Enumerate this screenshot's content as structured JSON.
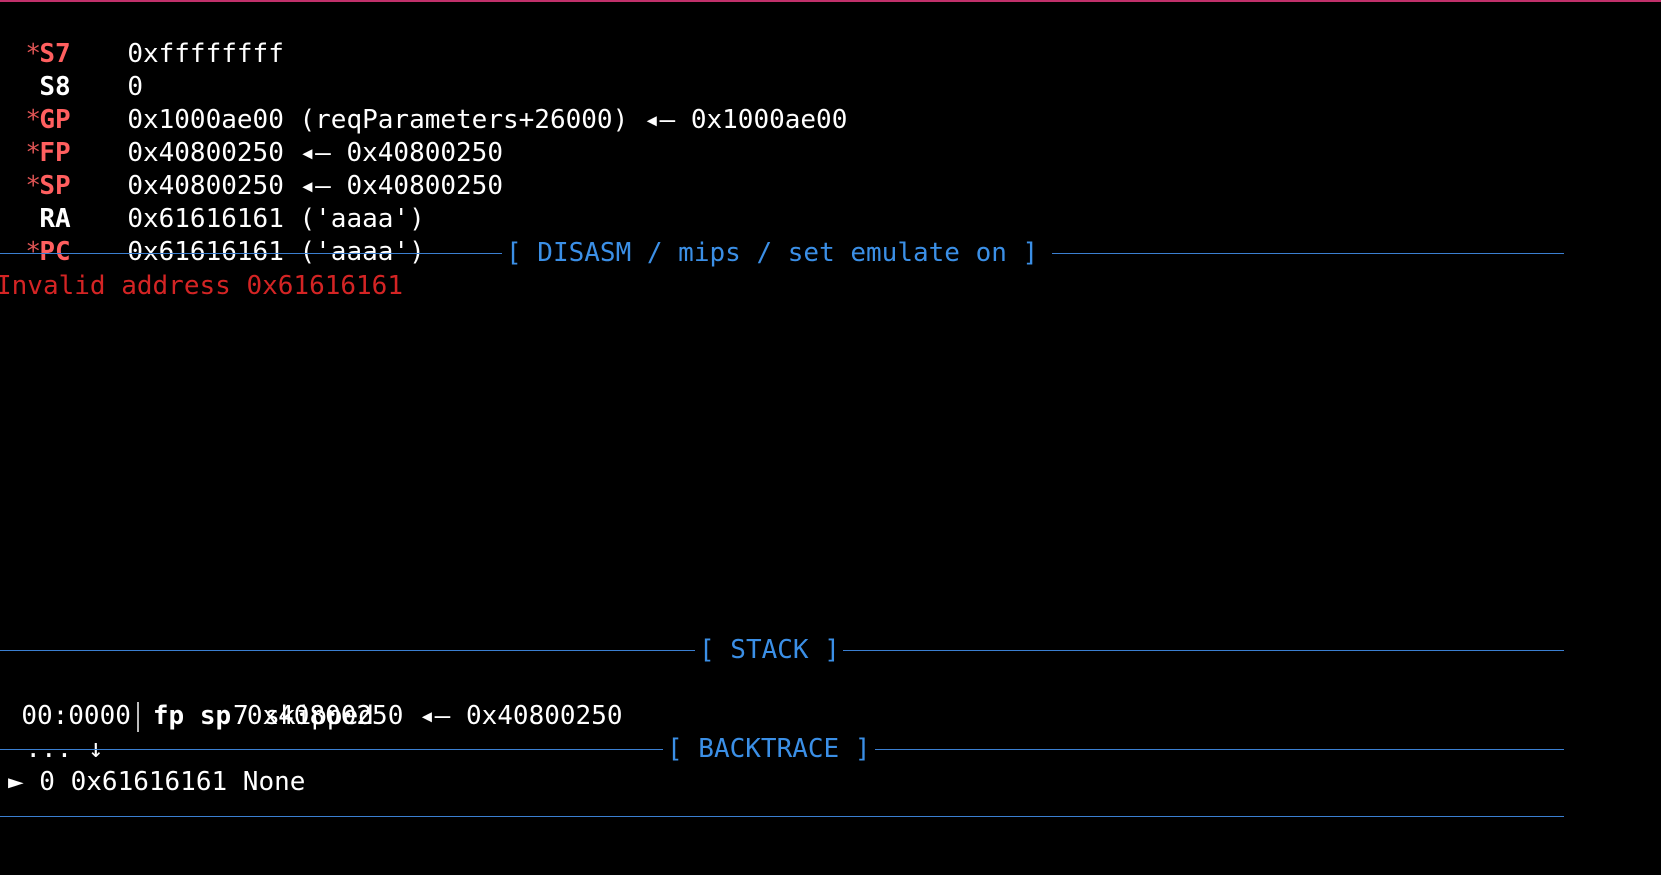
{
  "registers": [
    {
      "name": "S7",
      "changed": true,
      "value": "0xffffffff"
    },
    {
      "name": "S8",
      "changed": false,
      "value": "0"
    },
    {
      "name": "GP",
      "changed": true,
      "value": "0x1000ae00 (reqParameters+26000) ◂— 0x1000ae00"
    },
    {
      "name": "FP",
      "changed": true,
      "value": "0x40800250 ◂— 0x40800250"
    },
    {
      "name": "SP",
      "changed": true,
      "value": "0x40800250 ◂— 0x40800250"
    },
    {
      "name": "RA",
      "changed": false,
      "value": "0x61616161 ('aaaa')"
    },
    {
      "name": "PC",
      "changed": true,
      "value": "0x61616161 ('aaaa')"
    }
  ],
  "star": "*",
  "disasm": {
    "title": "[ DISASM / mips / set emulate on ]",
    "error": "Invalid address 0x61616161"
  },
  "stack": {
    "title": "[ STACK ]",
    "row_offset": "00:0000",
    "row_regs": "fp sp",
    "row_value": "0x40800250 ◂— 0x40800250",
    "skip_prefix": "... ↓",
    "skip_text": "7 skipped"
  },
  "backtrace": {
    "title": "[ BACKTRACE ]",
    "frame": "► 0 0x61616161 None"
  },
  "colors": {
    "changed_register": "#ff5f5f",
    "section": "#3b8fe6",
    "error": "#d42424"
  }
}
